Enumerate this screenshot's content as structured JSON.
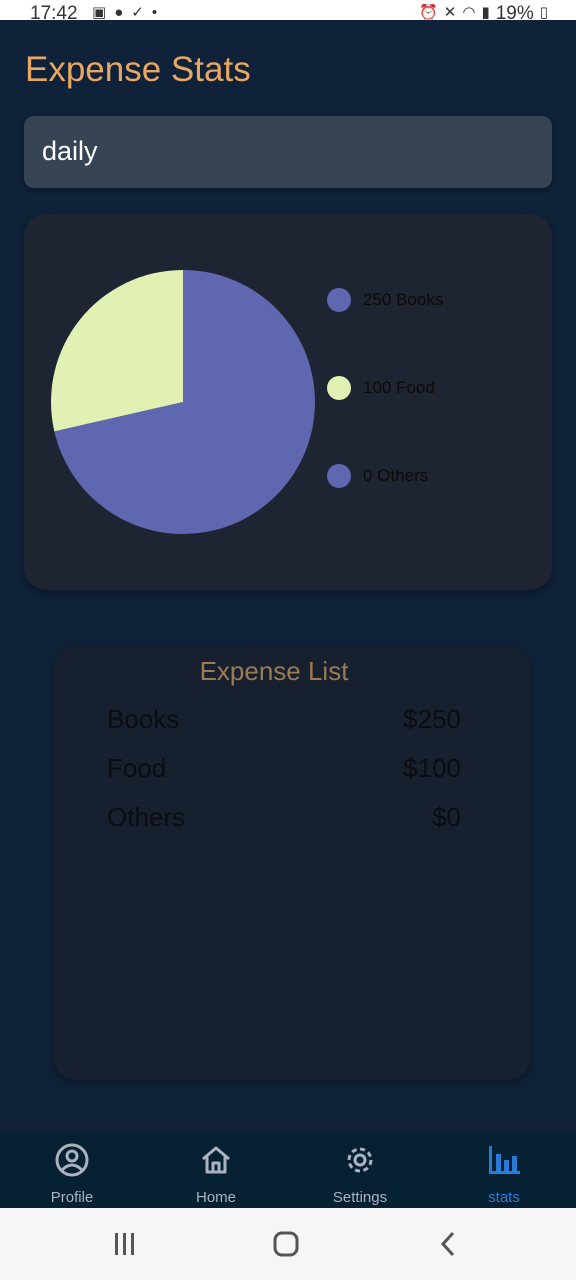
{
  "status_bar": {
    "time": "17:42",
    "battery": "19%",
    "icons_left": [
      "image-icon",
      "app-icon",
      "check-icon",
      "dot-icon"
    ],
    "icons_right": [
      "alarm-icon",
      "mute-icon",
      "wifi-icon",
      "volte-icon",
      "signal-icon",
      "battery-icon"
    ]
  },
  "header": {
    "title": "Expense Stats"
  },
  "period_selector": {
    "value": "daily"
  },
  "chart_data": {
    "type": "pie",
    "categories": [
      "Books",
      "Food",
      "Others"
    ],
    "values": [
      250,
      100,
      0
    ],
    "colors": [
      "#5e67b0",
      "#e1f0b3",
      "#5e67b0"
    ],
    "legend": [
      "250 Books",
      "100 Food",
      "0 Others"
    ],
    "legend_position": "right"
  },
  "expense_list": {
    "title": "Expense List",
    "items": [
      {
        "name": "Books",
        "amount": "$250"
      },
      {
        "name": "Food",
        "amount": "$100"
      },
      {
        "name": "Others",
        "amount": "$0"
      }
    ]
  },
  "bottom_nav": {
    "items": [
      {
        "label": "Profile",
        "icon": "profile-icon"
      },
      {
        "label": "Home",
        "icon": "home-icon"
      },
      {
        "label": "Settings",
        "icon": "settings-icon"
      },
      {
        "label": "stats",
        "icon": "stats-icon",
        "active": true
      }
    ],
    "active_color": "#2a7bd6"
  },
  "system_nav": {
    "buttons": [
      "recents-button",
      "home-button",
      "back-button"
    ]
  }
}
